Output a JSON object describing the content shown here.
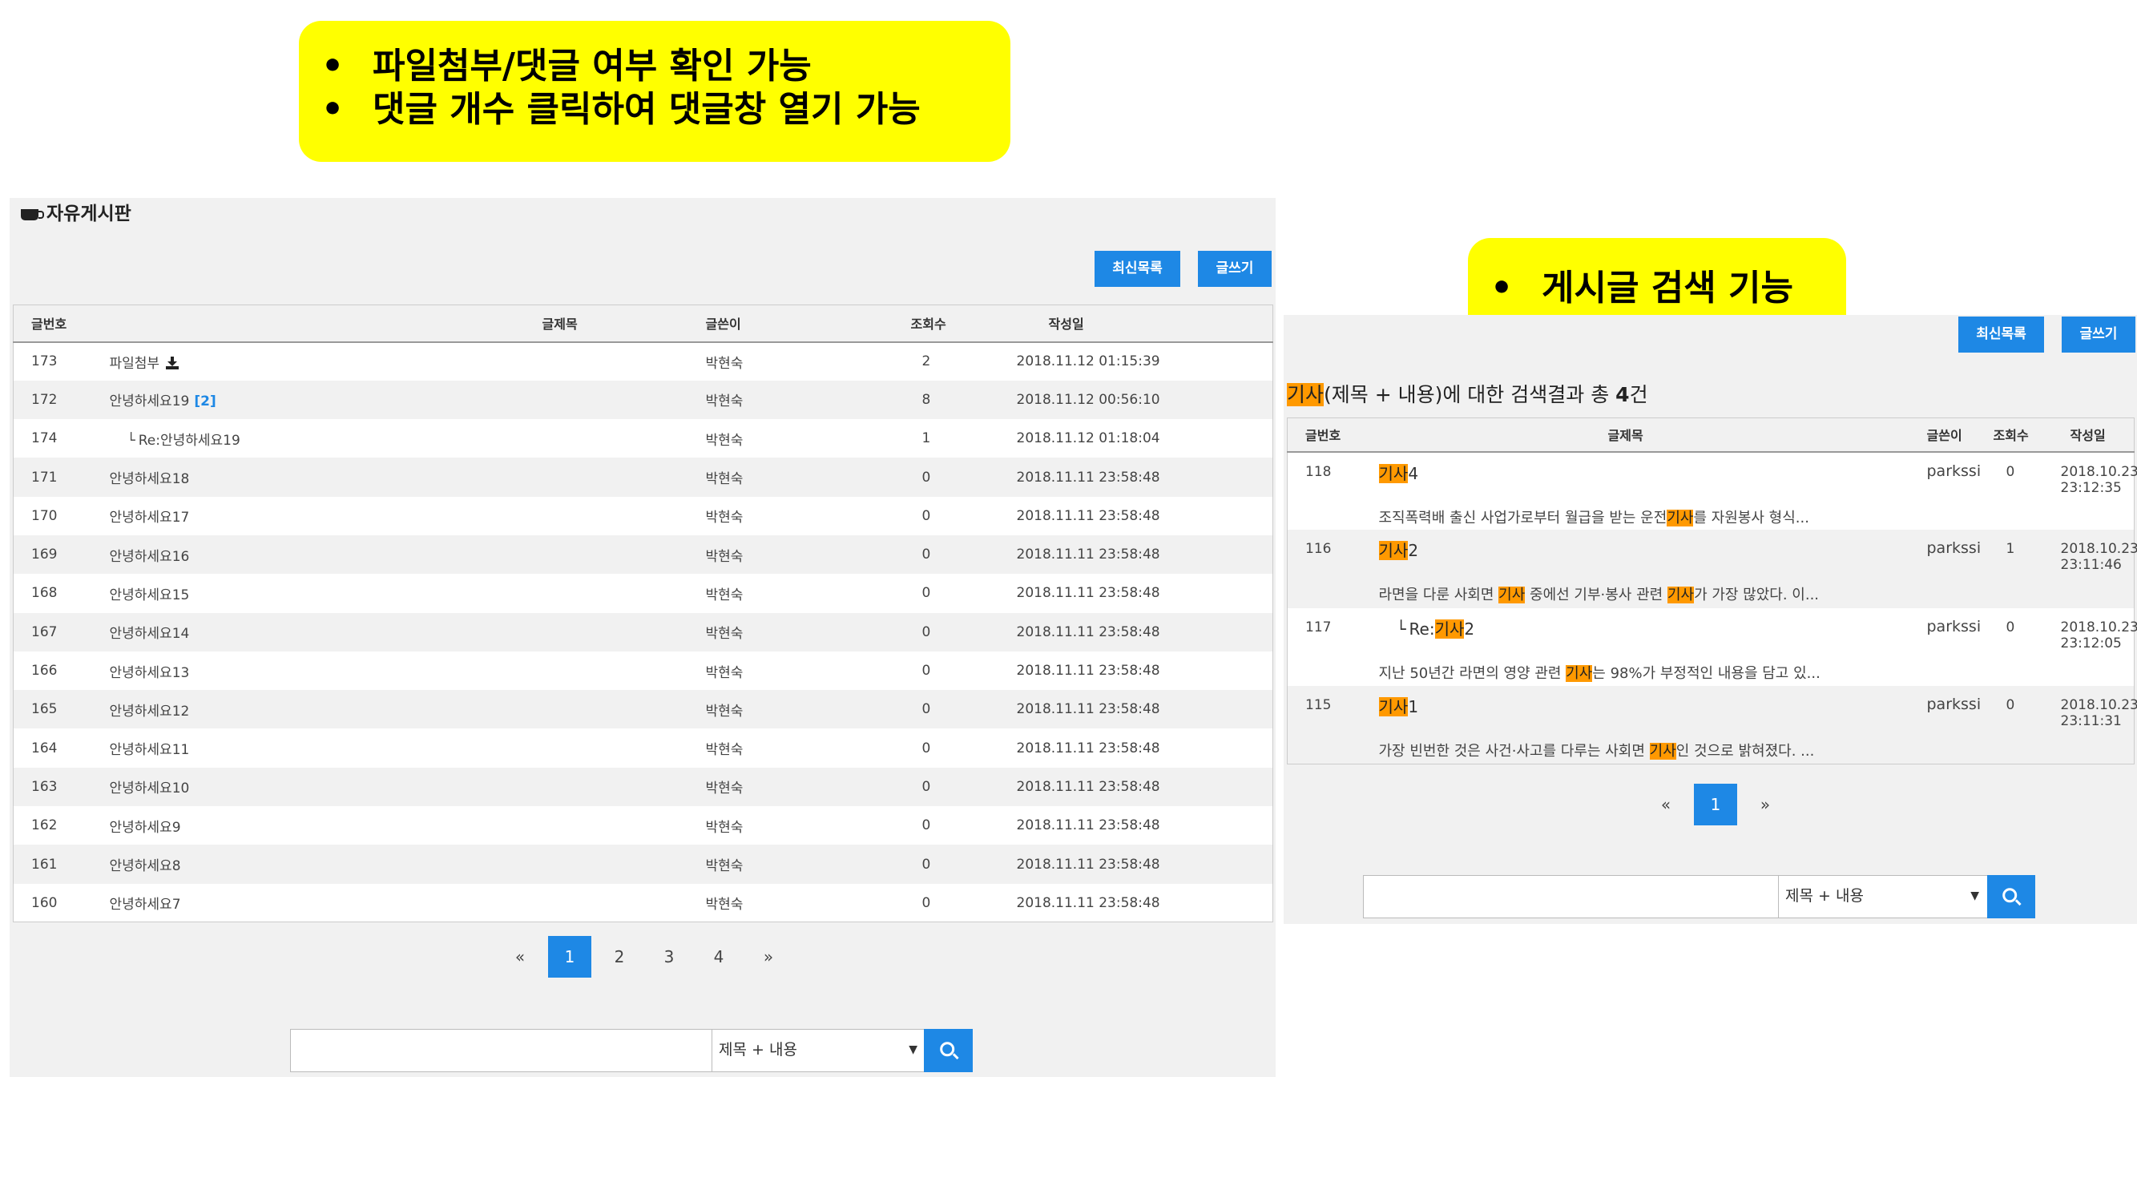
{
  "callout_left": {
    "lines": [
      "파일첨부/댓글 여부 확인 가능",
      "댓글 개수 클릭하여 댓글창 열기 가능"
    ]
  },
  "callout_right": {
    "lines": [
      "게시글 검색 기능"
    ]
  },
  "colors": {
    "accent": "#1e88e5",
    "highlight": "#ff9900",
    "callout": "#ffff00"
  },
  "left_board": {
    "title": "자유게시판",
    "icon": "coffee-cup-icon",
    "buttons": {
      "latest": "최신목록",
      "write": "글쓰기"
    },
    "columns": [
      "글번호",
      "글제목",
      "글쓴이",
      "조회수",
      "작성일"
    ],
    "rows": [
      {
        "no": "173",
        "title": "파일첨부",
        "author": "박현숙",
        "views": "2",
        "date": "2018.11.12 01:15:39",
        "attachment": true
      },
      {
        "no": "172",
        "title": "안녕하세요19",
        "comments": "[2]",
        "author": "박현숙",
        "views": "8",
        "date": "2018.11.12 00:56:10"
      },
      {
        "no": "174",
        "reply": "└",
        "title": "Re:안녕하세요19",
        "author": "박현숙",
        "views": "1",
        "date": "2018.11.12 01:18:04"
      },
      {
        "no": "171",
        "title": "안녕하세요18",
        "author": "박현숙",
        "views": "0",
        "date": "2018.11.11 23:58:48"
      },
      {
        "no": "170",
        "title": "안녕하세요17",
        "author": "박현숙",
        "views": "0",
        "date": "2018.11.11 23:58:48"
      },
      {
        "no": "169",
        "title": "안녕하세요16",
        "author": "박현숙",
        "views": "0",
        "date": "2018.11.11 23:58:48"
      },
      {
        "no": "168",
        "title": "안녕하세요15",
        "author": "박현숙",
        "views": "0",
        "date": "2018.11.11 23:58:48"
      },
      {
        "no": "167",
        "title": "안녕하세요14",
        "author": "박현숙",
        "views": "0",
        "date": "2018.11.11 23:58:48"
      },
      {
        "no": "166",
        "title": "안녕하세요13",
        "author": "박현숙",
        "views": "0",
        "date": "2018.11.11 23:58:48"
      },
      {
        "no": "165",
        "title": "안녕하세요12",
        "author": "박현숙",
        "views": "0",
        "date": "2018.11.11 23:58:48"
      },
      {
        "no": "164",
        "title": "안녕하세요11",
        "author": "박현숙",
        "views": "0",
        "date": "2018.11.11 23:58:48"
      },
      {
        "no": "163",
        "title": "안녕하세요10",
        "author": "박현숙",
        "views": "0",
        "date": "2018.11.11 23:58:48"
      },
      {
        "no": "162",
        "title": "안녕하세요9",
        "author": "박현숙",
        "views": "0",
        "date": "2018.11.11 23:58:48"
      },
      {
        "no": "161",
        "title": "안녕하세요8",
        "author": "박현숙",
        "views": "0",
        "date": "2018.11.11 23:58:48"
      },
      {
        "no": "160",
        "title": "안녕하세요7",
        "author": "박현숙",
        "views": "0",
        "date": "2018.11.11 23:58:48"
      }
    ],
    "pagination": {
      "prev": "«",
      "pages": [
        "1",
        "2",
        "3",
        "4"
      ],
      "active": "1",
      "next": "»"
    },
    "search": {
      "value": "",
      "select": "제목 + 내용"
    }
  },
  "right_board": {
    "buttons": {
      "latest": "최신목록",
      "write": "글쓰기"
    },
    "summary": {
      "keyword": "기사",
      "middle": "(제목 + 내용)에 대한 검색결과 총 ",
      "count": "4",
      "suffix": "건"
    },
    "columns": [
      "글번호",
      "글제목",
      "글쓴이",
      "조회수",
      "작성일"
    ],
    "rows": [
      {
        "no": "118",
        "title_parts": [
          {
            "t": "기사",
            "hl": true
          },
          {
            "t": "4"
          }
        ],
        "snippet_parts": [
          {
            "t": "조직폭력배 출신 사업가로부터 월급을 받는 운전"
          },
          {
            "t": "기사",
            "hl": true
          },
          {
            "t": "를 자원봉사 형식..."
          }
        ],
        "author": "parkssi",
        "views": "0",
        "date": "2018.10.23",
        "time": "23:12:35"
      },
      {
        "no": "116",
        "title_parts": [
          {
            "t": "기사",
            "hl": true
          },
          {
            "t": "2"
          }
        ],
        "snippet_parts": [
          {
            "t": "라면을 다룬 사회면 "
          },
          {
            "t": "기사",
            "hl": true
          },
          {
            "t": " 중에선 기부·봉사 관련 "
          },
          {
            "t": "기사",
            "hl": true
          },
          {
            "t": "가 가장 많았다. 이..."
          }
        ],
        "author": "parkssi",
        "views": "1",
        "date": "2018.10.23",
        "time": "23:11:46"
      },
      {
        "no": "117",
        "reply": "└",
        "title_parts": [
          {
            "t": "Re:"
          },
          {
            "t": "기사",
            "hl": true
          },
          {
            "t": "2"
          }
        ],
        "snippet_parts": [
          {
            "t": "지난 50년간 라면의 영양 관련 "
          },
          {
            "t": "기사",
            "hl": true
          },
          {
            "t": "는 98%가 부정적인 내용을 담고 있..."
          }
        ],
        "author": "parkssi",
        "views": "0",
        "date": "2018.10.23",
        "time": "23:12:05"
      },
      {
        "no": "115",
        "title_parts": [
          {
            "t": "기사",
            "hl": true
          },
          {
            "t": "1"
          }
        ],
        "snippet_parts": [
          {
            "t": "가장 빈번한 것은 사건·사고를 다루는 사회면 "
          },
          {
            "t": "기사",
            "hl": true
          },
          {
            "t": "인 것으로 밝혀졌다. ..."
          }
        ],
        "author": "parkssi",
        "views": "0",
        "date": "2018.10.23",
        "time": "23:11:31"
      }
    ],
    "pagination": {
      "prev": "«",
      "pages": [
        "1"
      ],
      "active": "1",
      "next": "»"
    },
    "search": {
      "value": "",
      "select": "제목 + 내용"
    }
  }
}
